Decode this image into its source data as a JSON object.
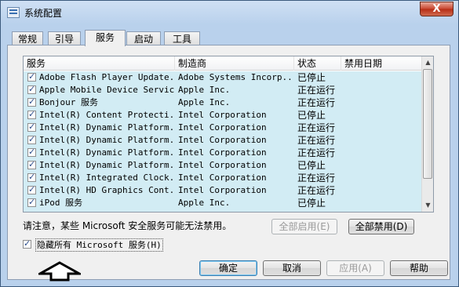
{
  "window": {
    "title": "系统配置",
    "close": "X"
  },
  "tabs": [
    "常规",
    "引导",
    "服务",
    "启动",
    "工具"
  ],
  "table": {
    "headers": [
      "服务",
      "制造商",
      "状态",
      "禁用日期"
    ],
    "rows": [
      {
        "name": "Adobe Flash Player Update...",
        "vendor": "Adobe Systems Incorp...",
        "status": "已停止",
        "date": ""
      },
      {
        "name": "Apple Mobile Device Service",
        "vendor": "Apple Inc.",
        "status": "正在运行",
        "date": ""
      },
      {
        "name": "Bonjour 服务",
        "vendor": "Apple Inc.",
        "status": "正在运行",
        "date": ""
      },
      {
        "name": "Intel(R) Content Protecti...",
        "vendor": "Intel Corporation",
        "status": "已停止",
        "date": ""
      },
      {
        "name": "Intel(R) Dynamic Platform...",
        "vendor": "Intel Corporation",
        "status": "正在运行",
        "date": ""
      },
      {
        "name": "Intel(R) Dynamic Platform...",
        "vendor": "Intel Corporation",
        "status": "正在运行",
        "date": ""
      },
      {
        "name": "Intel(R) Dynamic Platform...",
        "vendor": "Intel Corporation",
        "status": "正在运行",
        "date": ""
      },
      {
        "name": "Intel(R) Dynamic Platform...",
        "vendor": "Intel Corporation",
        "status": "已停止",
        "date": ""
      },
      {
        "name": "Intel(R) Integrated Clock...",
        "vendor": "Intel Corporation",
        "status": "正在运行",
        "date": ""
      },
      {
        "name": "Intel(R) HD Graphics Cont...",
        "vendor": "Intel Corporation",
        "status": "正在运行",
        "date": ""
      },
      {
        "name": "iPod 服务",
        "vendor": "Apple Inc.",
        "status": "已停止",
        "date": ""
      }
    ]
  },
  "note": "请注意，某些 Microsoft 安全服务可能无法禁用。",
  "buttons": {
    "enable_all": "全部启用(E)",
    "disable_all": "全部禁用(D)",
    "ok": "确定",
    "cancel": "取消",
    "apply": "应用(A)",
    "help": "帮助"
  },
  "hide_ms": "隐藏所有 Microsoft 服务(H)"
}
